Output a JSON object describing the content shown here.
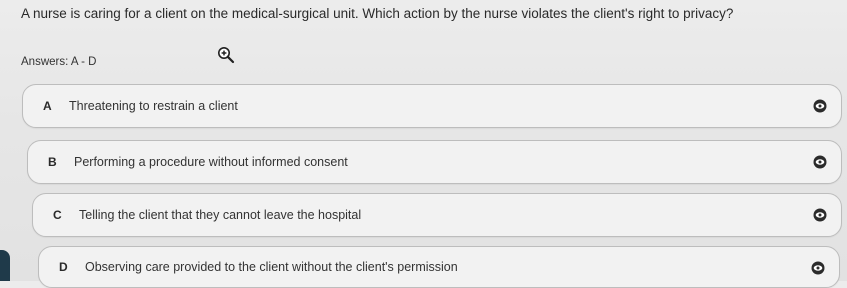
{
  "question": {
    "text": "A nurse is caring for a client on the medical-surgical unit. Which action by the nurse violates the client's right to privacy?"
  },
  "answers": {
    "text": "Answers: A - D"
  },
  "options": [
    {
      "letter": "A",
      "text": "Threatening to restrain a client"
    },
    {
      "letter": "B",
      "text": "Performing a procedure without informed consent"
    },
    {
      "letter": "C",
      "text": "Telling the client that they cannot leave the hospital"
    },
    {
      "letter": "D",
      "text": "Observing care provided to the client without the client's permission"
    }
  ],
  "icons": {
    "zoom": "zoom-in-icon",
    "option_action": "eye-icon"
  },
  "colors": {
    "background": "#e8e8e8",
    "option_border": "#bdbdbd",
    "icon": "#2b2b2b"
  }
}
